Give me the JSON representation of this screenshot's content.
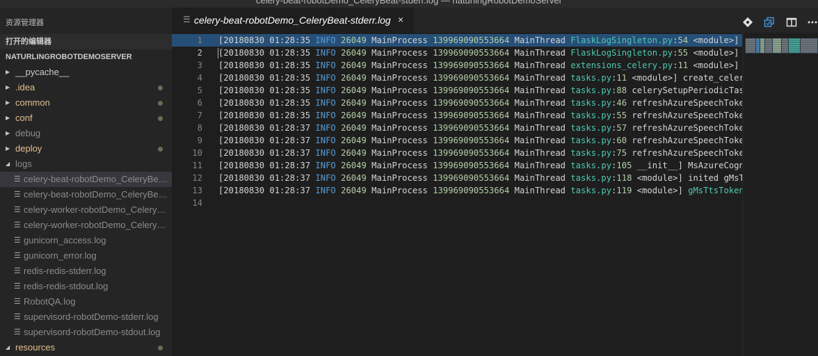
{
  "window": {
    "title": "celery-beat-robotDemo_CeleryBeat-stderr.log — naturlingRobotDemoServer"
  },
  "sidebar": {
    "title": "资源管理器",
    "open_editors_label": "打开的编辑器",
    "project_label": "NATURLINGROBOTDEMOSERVER",
    "items": [
      {
        "kind": "folder",
        "label": "__pycache__",
        "expanded": false,
        "status": "normal",
        "modified": false
      },
      {
        "kind": "folder",
        "label": ".idea",
        "expanded": false,
        "status": "modified",
        "modified": true
      },
      {
        "kind": "folder",
        "label": "common",
        "expanded": false,
        "status": "modified",
        "modified": true
      },
      {
        "kind": "folder",
        "label": "conf",
        "expanded": false,
        "status": "modified",
        "modified": true
      },
      {
        "kind": "folder",
        "label": "debug",
        "expanded": false,
        "status": "ignored",
        "modified": false
      },
      {
        "kind": "folder",
        "label": "deploy",
        "expanded": false,
        "status": "modified",
        "modified": true
      },
      {
        "kind": "folder",
        "label": "logs",
        "expanded": true,
        "status": "ignored",
        "modified": false
      },
      {
        "kind": "file",
        "label": "celery-beat-robotDemo_CeleryBeat-stderr.log",
        "status": "ignored",
        "selected": true
      },
      {
        "kind": "file",
        "label": "celery-beat-robotDemo_CeleryBeat-stdout.log",
        "status": "ignored"
      },
      {
        "kind": "file",
        "label": "celery-worker-robotDemo_CeleryWorker-stderr.log",
        "status": "ignored"
      },
      {
        "kind": "file",
        "label": "celery-worker-robotDemo_CeleryWorker-stdout.log",
        "status": "ignored"
      },
      {
        "kind": "file",
        "label": "gunicorn_access.log",
        "status": "ignored"
      },
      {
        "kind": "file",
        "label": "gunicorn_error.log",
        "status": "ignored"
      },
      {
        "kind": "file",
        "label": "redis-redis-stderr.log",
        "status": "ignored"
      },
      {
        "kind": "file",
        "label": "redis-redis-stdout.log",
        "status": "ignored"
      },
      {
        "kind": "file",
        "label": "RobotQA.log",
        "status": "ignored"
      },
      {
        "kind": "file",
        "label": "supervisord-robotDemo-stderr.log",
        "status": "ignored"
      },
      {
        "kind": "file",
        "label": "supervisord-robotDemo-stdout.log",
        "status": "ignored"
      },
      {
        "kind": "folder",
        "label": "resources",
        "expanded": true,
        "status": "modified",
        "modified": true
      }
    ]
  },
  "editor": {
    "tab": {
      "label": "celery-beat-robotDemo_CeleryBeat-stderr.log",
      "close_glyph": "×"
    },
    "actions": [
      "git-compare-icon",
      "open-changes-icon",
      "split-editor-icon",
      "more-actions-icon"
    ],
    "cursor_line": 2,
    "selected_line": 1,
    "lines": [
      {
        "n": "1",
        "date": "[20180830 01:28:35",
        "level": "INFO",
        "pid": "26049",
        "proc": "MainProcess",
        "tid": "139969090553664",
        "thread": "MainThread",
        "src": "FlaskLogSingleton.py",
        "lineno": "54",
        "rest": " <module>] Lo"
      },
      {
        "n": "2",
        "date": "[20180830 01:28:35",
        "level": "INFO",
        "pid": "26049",
        "proc": "MainProcess",
        "tid": "139969090553664",
        "thread": "MainThread",
        "src": "FlaskLogSingleton.py",
        "lineno": "55",
        "rest": " <module>] lo"
      },
      {
        "n": "3",
        "date": "[20180830 01:28:35",
        "level": "INFO",
        "pid": "26049",
        "proc": "MainProcess",
        "tid": "139969090553664",
        "thread": "MainThread",
        "src": "extensions_celery.py",
        "lineno": "11",
        "rest": " <module>] ex"
      },
      {
        "n": "4",
        "date": "[20180830 01:28:35",
        "level": "INFO",
        "pid": "26049",
        "proc": "MainProcess",
        "tid": "139969090553664",
        "thread": "MainThread",
        "src": "tasks.py",
        "lineno": "11",
        "rest": " <module>] create_celery_"
      },
      {
        "n": "5",
        "date": "[20180830 01:28:35",
        "level": "INFO",
        "pid": "26049",
        "proc": "MainProcess",
        "tid": "139969090553664",
        "thread": "MainThread",
        "src": "tasks.py",
        "lineno": "88",
        "rest": " celerySetupPeriodicTasks"
      },
      {
        "n": "6",
        "date": "[20180830 01:28:35",
        "level": "INFO",
        "pid": "26049",
        "proc": "MainProcess",
        "tid": "139969090553664",
        "thread": "MainThread",
        "src": "tasks.py",
        "lineno": "46",
        "rest": " refreshAzureSpeechToken]"
      },
      {
        "n": "7",
        "date": "[20180830 01:28:35",
        "level": "INFO",
        "pid": "26049",
        "proc": "MainProcess",
        "tid": "139969090553664",
        "thread": "MainThread",
        "src": "tasks.py",
        "lineno": "55",
        "rest": " refreshAzureSpeechToken]"
      },
      {
        "n": "8",
        "date": "[20180830 01:28:37",
        "level": "INFO",
        "pid": "26049",
        "proc": "MainProcess",
        "tid": "139969090553664",
        "thread": "MainThread",
        "src": "tasks.py",
        "lineno": "57",
        "rest": " refreshAzureSpeechToken]"
      },
      {
        "n": "9",
        "date": "[20180830 01:28:37",
        "level": "INFO",
        "pid": "26049",
        "proc": "MainProcess",
        "tid": "139969090553664",
        "thread": "MainThread",
        "src": "tasks.py",
        "lineno": "60",
        "rest": " refreshAzureSpeechToken]"
      },
      {
        "n": "10",
        "date": "[20180830 01:28:37",
        "level": "INFO",
        "pid": "26049",
        "proc": "MainProcess",
        "tid": "139969090553664",
        "thread": "MainThread",
        "src": "tasks.py",
        "lineno": "75",
        "rest": " refreshAzureSpeechToken]"
      },
      {
        "n": "11",
        "date": "[20180830 01:28:37",
        "level": "INFO",
        "pid": "26049",
        "proc": "MainProcess",
        "tid": "139969090553664",
        "thread": "MainThread",
        "src": "tasks.py",
        "lineno": "105",
        "rest": " __init__] MsAzureCognit"
      },
      {
        "n": "12",
        "date": "[20180830 01:28:37",
        "level": "INFO",
        "pid": "26049",
        "proc": "MainProcess",
        "tid": "139969090553664",
        "thread": "MainThread",
        "src": "tasks.py",
        "lineno": "118",
        "rest": " <module>] inited gMsTts"
      },
      {
        "n": "13",
        "date": "[20180830 01:28:37",
        "level": "INFO",
        "pid": "26049",
        "proc": "MainProcess",
        "tid": "139969090553664",
        "thread": "MainThread",
        "src": "tasks.py",
        "lineno": "119",
        "rest": " <module>] ",
        "tail": "gMsTtsTokenSi"
      },
      {
        "n": "14"
      }
    ]
  },
  "colors": {
    "sidebar_bg": "#252526",
    "editor_bg": "#1e1e1e",
    "selection": "#264f78",
    "modified_folder": "#e2c08d",
    "ignored_file": "#8c8c8c",
    "log_level": "#569cd6",
    "number": "#b5cea8",
    "source_file": "#4ec9b0"
  }
}
